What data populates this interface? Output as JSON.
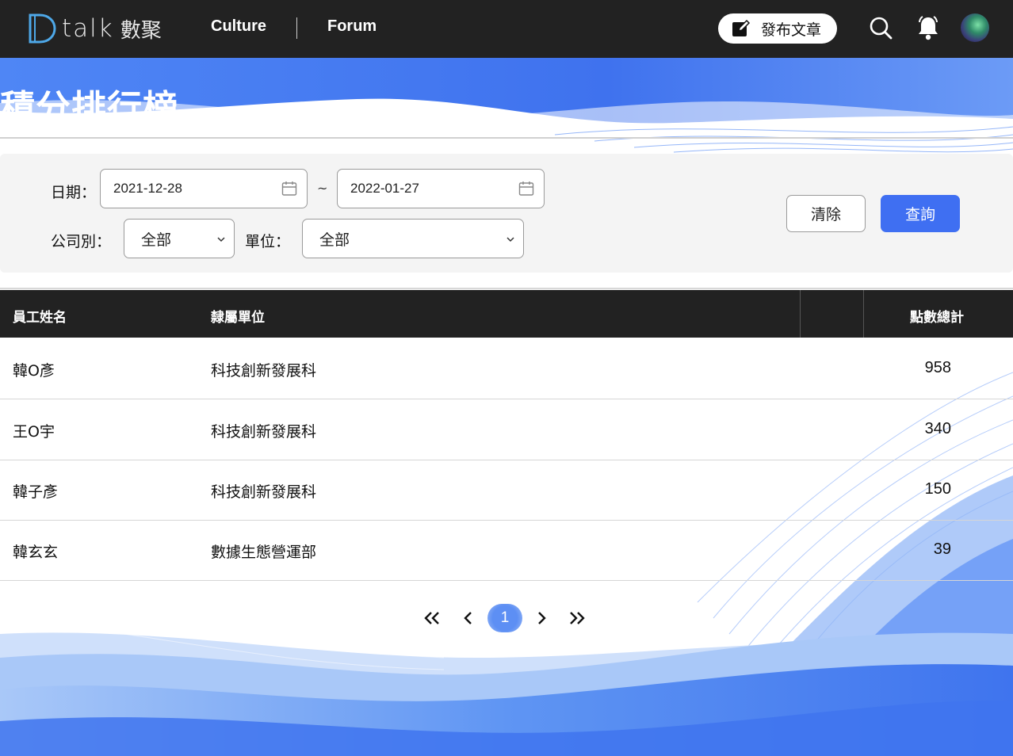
{
  "nav": {
    "logo_text": "talk",
    "logo_sub": "數聚",
    "links": [
      "Culture",
      "Forum"
    ],
    "post_button": "發布文章"
  },
  "banner": {
    "title": "積分排行榜"
  },
  "filters": {
    "date_label": "日期：",
    "date_from": "2021-12-28",
    "date_sep": "~",
    "date_to": "2022-01-27",
    "company_label": "公司別：",
    "company_value": "全部",
    "unit_label": "單位：",
    "unit_value": "全部",
    "clear_button": "清除",
    "query_button": "查詢"
  },
  "table": {
    "headers": {
      "name": "員工姓名",
      "unit": "隸屬單位",
      "total": "點數總計"
    },
    "rows": [
      {
        "name": "韓O彥",
        "unit": "科技創新發展科",
        "total": "958"
      },
      {
        "name": "王O宇",
        "unit": "科技創新發展科",
        "total": "340"
      },
      {
        "name": "韓子彥",
        "unit": "科技創新發展科",
        "total": "150"
      },
      {
        "name": "韓玄玄",
        "unit": "數據生態營運部",
        "total": "39"
      }
    ]
  },
  "pagination": {
    "current": "1"
  },
  "colors": {
    "accent": "#3f6ff2",
    "topbar": "#222222",
    "wave": "#4f86f5"
  }
}
